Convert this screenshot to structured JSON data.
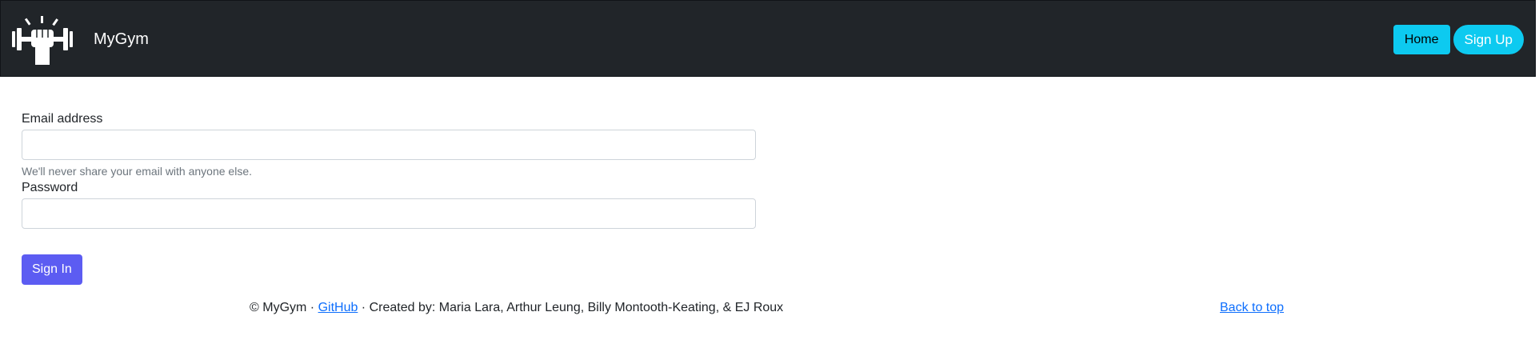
{
  "header": {
    "brand_name": "MyGym",
    "logo_icon": "dumbbell-fist-icon",
    "nav": {
      "home_label": "Home",
      "signup_label": "Sign Up"
    }
  },
  "form": {
    "email_label": "Email address",
    "email_value": "",
    "email_help": "We'll never share your email with anyone else.",
    "password_label": "Password",
    "password_value": "",
    "submit_label": "Sign In"
  },
  "footer": {
    "copyright": "© MyGym · ",
    "github_label": "GitHub",
    "credits": " · Created by: Maria Lara, Arthur Leung, Billy Montooth-Keating, & EJ Roux",
    "back_to_top_label": "Back to top"
  },
  "colors": {
    "navbar_bg": "#212529",
    "nav_button": "#0dcaf0",
    "signin_button": "#5c5cf2",
    "link": "#0d6efd"
  }
}
